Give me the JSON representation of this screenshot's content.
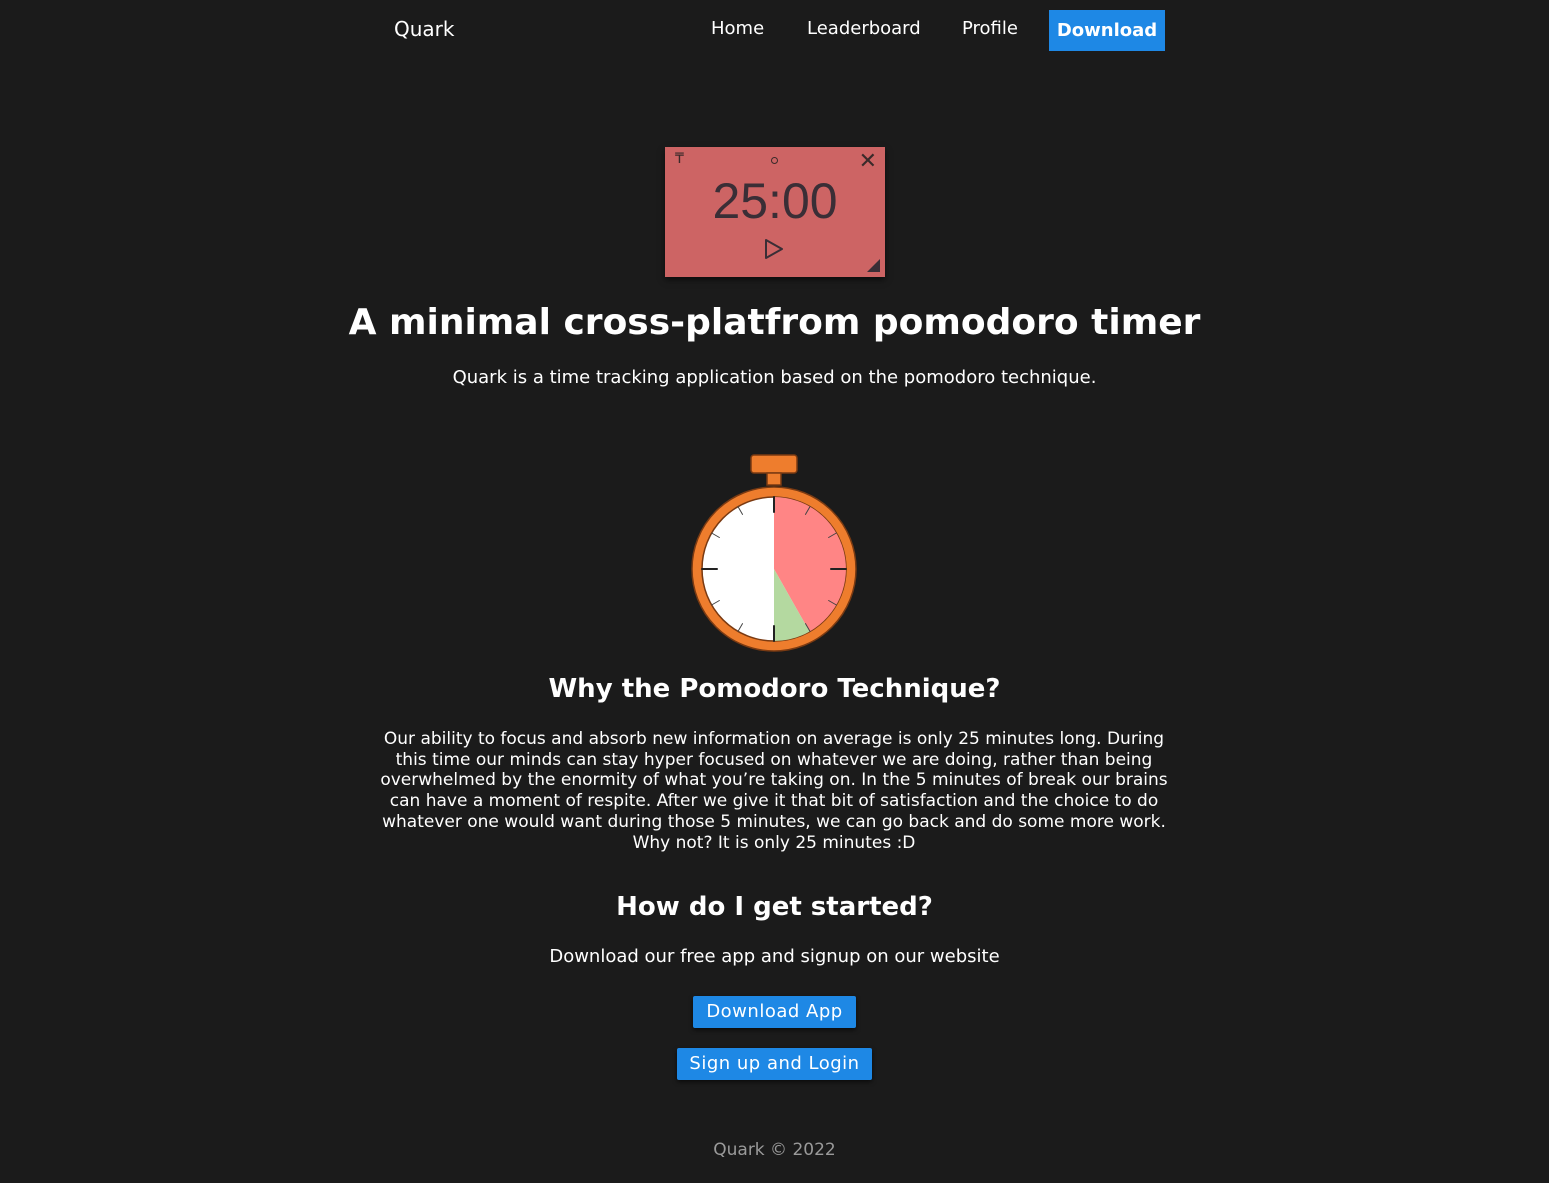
{
  "nav": {
    "brand": "Quark",
    "links": [
      {
        "label": "Home"
      },
      {
        "label": "Leaderboard"
      },
      {
        "label": "Profile"
      }
    ],
    "download_label": "Download"
  },
  "timer_widget": {
    "time": "25:00",
    "pin_glyph": "₸",
    "close_glyph": "✕"
  },
  "hero": {
    "title": "A minimal cross-platfrom pomodoro timer",
    "subtitle": "Quark is a time tracking application based on the pomodoro technique."
  },
  "why": {
    "heading": "Why the Pomodoro Technique?",
    "body": "Our ability to focus and absorb new information on average is only 25 minutes long. During this time our minds can stay hyper focused on whatever we are doing, rather than being overwhelmed by the enormity of what you’re taking on. In the 5 minutes of break our brains can have a moment of respite. After we give it that bit of satisfaction and the choice to do whatever one would want during those 5 minutes, we can go back and do some more work. Why not? It is only 25 minutes :D"
  },
  "started": {
    "heading": "How do I get started?",
    "text": "Download our free app and signup on our website",
    "download_app_label": "Download App",
    "signup_label": "Sign up and Login"
  },
  "footer": {
    "text": "Quark © 2022"
  },
  "colors": {
    "background": "#1b1b1b",
    "accent": "#1e88e5",
    "timer_widget": "#cd6464",
    "clock_ring": "#ee7d2d",
    "clock_work": "#ff8585",
    "clock_break": "#b4d9a0"
  }
}
